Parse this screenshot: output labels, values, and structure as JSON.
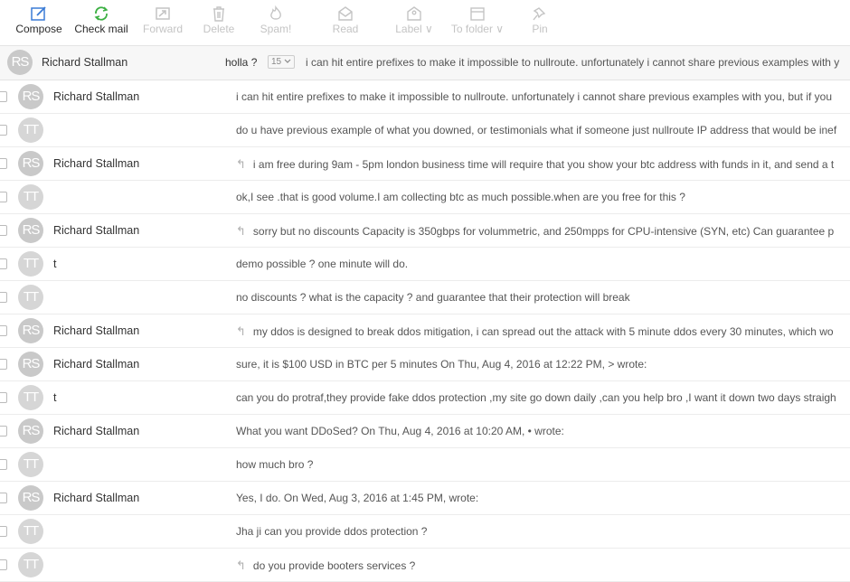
{
  "toolbar": {
    "compose": "Compose",
    "check_mail": "Check mail",
    "forward": "Forward",
    "delete": "Delete",
    "spam": "Spam!",
    "read": "Read",
    "label": "Label ∨",
    "to_folder": "To folder ∨",
    "pin": "Pin"
  },
  "thread": {
    "initials": "RS",
    "sender": "Richard Stallman",
    "subject": "holla ?",
    "count": "15",
    "preview": "i can hit entire prefixes to make it impossible to nullroute. unfortunately i cannot share previous examples with y"
  },
  "reply_glyph": "↰",
  "messages": [
    {
      "initials": "RS",
      "sender": "Richard Stallman",
      "reply": false,
      "preview": "i can hit entire prefixes to make it impossible to nullroute. unfortunately i cannot share previous examples with you, but if you"
    },
    {
      "initials": "TT",
      "sender": "",
      "reply": false,
      "preview": "do u have previous example of what you downed, or testimonials what if someone just nullroute IP address that would be inef"
    },
    {
      "initials": "RS",
      "sender": "Richard Stallman",
      "reply": true,
      "preview": "i am free during 9am - 5pm london business time will require that you show your btc address with funds in it, and send a t"
    },
    {
      "initials": "TT",
      "sender": "",
      "reply": false,
      "preview": "ok,I see .that is good volume.I am collecting btc as much possible.when are you free for this ?"
    },
    {
      "initials": "RS",
      "sender": "Richard Stallman",
      "reply": true,
      "preview": "sorry but no discounts Capacity is 350gbps for volummetric, and 250mpps for CPU-intensive (SYN, etc) Can guarantee p"
    },
    {
      "initials": "TT",
      "sender": "t",
      "reply": false,
      "preview": "demo possible ? one minute will do."
    },
    {
      "initials": "TT",
      "sender": "",
      "reply": false,
      "preview": "no discounts ? what is the capacity ? and guarantee that their protection will break"
    },
    {
      "initials": "RS",
      "sender": "Richard Stallman",
      "reply": true,
      "preview": "my ddos is designed to break ddos mitigation, i can spread out the attack with 5 minute ddos every 30 minutes, which wo"
    },
    {
      "initials": "RS",
      "sender": "Richard Stallman",
      "reply": false,
      "preview": "sure, it is $100 USD in BTC per 5 minutes On Thu, Aug 4, 2016 at 12:22 PM,                                          > wrote:"
    },
    {
      "initials": "TT",
      "sender": "t",
      "reply": false,
      "preview": "can you do protraf,they provide fake ddos protection ,my site go down daily ,can you help bro ,I want it down two days straigh"
    },
    {
      "initials": "RS",
      "sender": "Richard Stallman",
      "reply": false,
      "preview": "What you want DDoSed? On Thu, Aug 4, 2016 at 10:20 AM,                                          • wrote:"
    },
    {
      "initials": "TT",
      "sender": "",
      "reply": false,
      "preview": "how much bro ?"
    },
    {
      "initials": "RS",
      "sender": "Richard Stallman",
      "reply": false,
      "preview": "Yes, I do. On Wed, Aug 3, 2016 at 1:45 PM,                                          wrote:"
    },
    {
      "initials": "TT",
      "sender": "",
      "reply": false,
      "preview": "Jha ji can you provide ddos protection ?"
    },
    {
      "initials": "TT",
      "sender": "",
      "reply": true,
      "preview": "do you provide booters services ?"
    }
  ],
  "colors": {
    "accent": "#3a7bd5",
    "green": "#3cb043",
    "disabled": "#c4c4c4"
  }
}
